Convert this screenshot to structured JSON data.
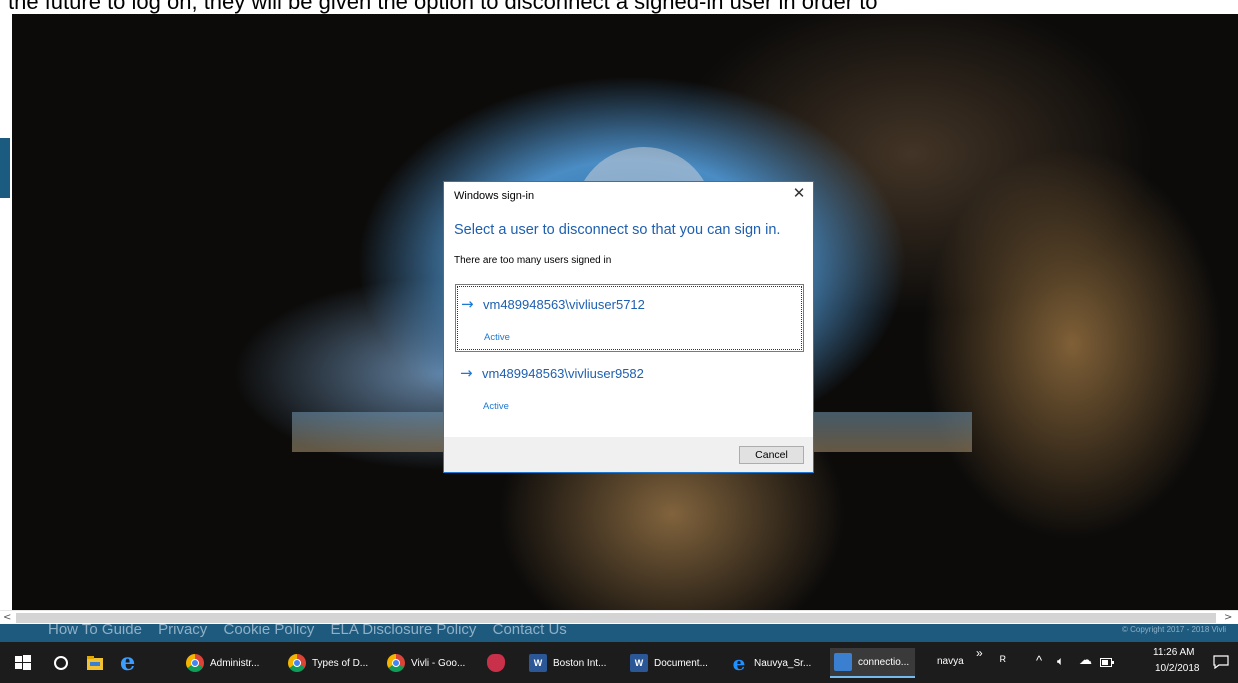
{
  "document_top_text": "the future to log on, they will be given the option to disconnect a signed-in user in order to",
  "dialog": {
    "title": "Windows sign-in",
    "close_glyph": "✕",
    "heading": "Select a user to disconnect so that you can sign in.",
    "subtitle": "There are too many users signed in",
    "users": [
      {
        "name": "vm489948563\\vivliuser5712",
        "status": "Active",
        "selected": true
      },
      {
        "name": "vm489948563\\vivliuser9582",
        "status": "Active",
        "selected": false
      }
    ],
    "cancel_label": "Cancel",
    "arrow_glyph": "→"
  },
  "footer": {
    "links": [
      "How To Guide",
      "Privacy",
      "Cookie Policy",
      "ELA Disclosure Policy",
      "Contact Us"
    ],
    "copyright": "© Copyright 2017 - 2018 Vivli"
  },
  "taskbar": {
    "items": [
      {
        "label": "Administr...",
        "icon": "chrome-icon"
      },
      {
        "label": "Types of D...",
        "icon": "chrome-icon"
      },
      {
        "label": "Vivli - Goo...",
        "icon": "chrome-icon"
      },
      {
        "label": "",
        "icon": "shield-icon"
      },
      {
        "label": "Boston Int...",
        "icon": "word-icon"
      },
      {
        "label": "Document...",
        "icon": "word-icon"
      },
      {
        "label": "Nauvya_Sr...",
        "icon": "ie-icon"
      },
      {
        "label": "connectio...",
        "icon": "remote-desktop-icon"
      }
    ],
    "toolbar_label": "navya",
    "overflow_glyph": "»",
    "time": "11:26 AM",
    "date": "10/2/2018"
  },
  "colors": {
    "accent_blue": "#1e78d2",
    "heading_blue": "#1e5fb0",
    "taskbar": "#1c1c1c",
    "footer": "#1d5a7e"
  }
}
